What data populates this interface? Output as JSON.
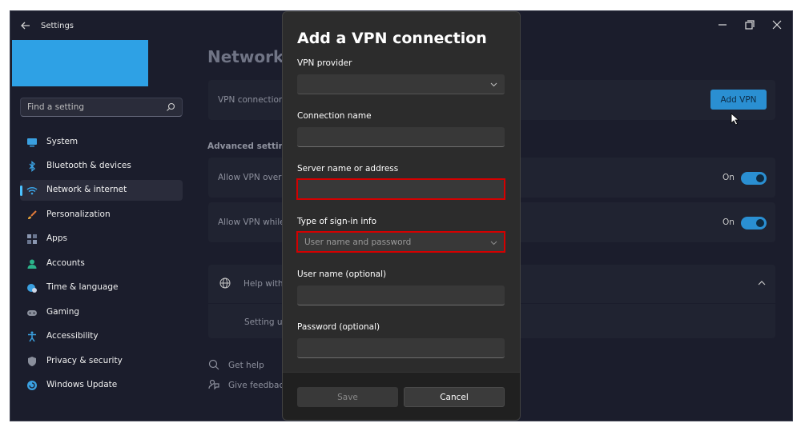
{
  "window": {
    "app_title": "Settings",
    "controls": [
      "minimize-icon",
      "restore-icon",
      "close-icon"
    ]
  },
  "colors": {
    "accent": "#2ea1e5",
    "highlight": "#d40000",
    "toggle_on": "#2a8fd2"
  },
  "sidebar": {
    "search": {
      "placeholder": "Find a setting"
    },
    "items": [
      {
        "label": "System",
        "icon": "monitor-icon"
      },
      {
        "label": "Bluetooth & devices",
        "icon": "bluetooth-icon"
      },
      {
        "label": "Network & internet",
        "icon": "wifi-icon",
        "active": true
      },
      {
        "label": "Personalization",
        "icon": "brush-icon"
      },
      {
        "label": "Apps",
        "icon": "apps-icon"
      },
      {
        "label": "Accounts",
        "icon": "person-icon"
      },
      {
        "label": "Time & language",
        "icon": "globe-clock-icon"
      },
      {
        "label": "Gaming",
        "icon": "gamepad-icon"
      },
      {
        "label": "Accessibility",
        "icon": "accessibility-icon"
      },
      {
        "label": "Privacy & security",
        "icon": "shield-icon"
      },
      {
        "label": "Windows Update",
        "icon": "update-icon"
      }
    ]
  },
  "main": {
    "page_title": "Network &",
    "vpn_connections_label": "VPN connections",
    "add_vpn_label": "Add VPN",
    "advanced_settings_label": "Advanced settings f",
    "allow_vpn_metered_label": "Allow VPN over m",
    "allow_vpn_roaming_label": "Allow VPN while",
    "toggle_metered_state": "On",
    "toggle_roaming_state": "On",
    "help_label": "Help with",
    "setting_up_label": "Setting up",
    "get_help_label": "Get help",
    "give_feedback_label": "Give feedback"
  },
  "dialog": {
    "title": "Add a VPN connection",
    "vpn_provider_label": "VPN provider",
    "vpn_provider_value": "",
    "connection_name_label": "Connection name",
    "connection_name_value": "",
    "server_label": "Server name or address",
    "server_value": "",
    "signin_type_label": "Type of sign-in info",
    "signin_type_value": "User name and password",
    "username_label": "User name (optional)",
    "username_value": "",
    "password_label": "Password (optional)",
    "password_value": "",
    "save_label": "Save",
    "cancel_label": "Cancel"
  }
}
